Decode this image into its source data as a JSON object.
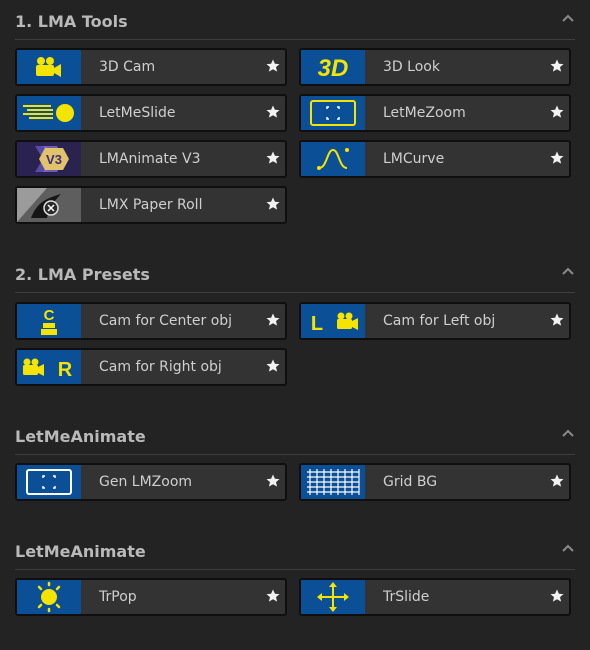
{
  "colors": {
    "background": "#232323",
    "item_bg": "#333333",
    "thumb_blue": "#0b4f96",
    "icon_yellow": "#f5e400",
    "text": "#cfcfcf",
    "header_text": "#b9b9b9"
  },
  "sections": [
    {
      "title": "1. LMA Tools",
      "items": [
        {
          "label": "3D Cam",
          "icon": "camera-icon"
        },
        {
          "label": "3D Look",
          "icon": "3d-text-icon"
        },
        {
          "label": "LetMeSlide",
          "icon": "slide-icon"
        },
        {
          "label": "LetMeZoom",
          "icon": "zoom-frame-icon"
        },
        {
          "label": "LMAnimate V3",
          "icon": "v3-logo-icon"
        },
        {
          "label": "LMCurve",
          "icon": "curve-icon"
        },
        {
          "label": "LMX Paper Roll",
          "icon": "paper-roll-icon"
        }
      ]
    },
    {
      "title": "2. LMA Presets",
      "items": [
        {
          "label": "Cam for Center obj",
          "icon": "center-cam-icon"
        },
        {
          "label": "Cam for Left obj",
          "icon": "left-cam-icon"
        },
        {
          "label": "Cam for Right obj",
          "icon": "right-cam-icon"
        }
      ]
    },
    {
      "title": "LetMeAnimate",
      "items": [
        {
          "label": "Gen LMZoom",
          "icon": "zoom-frame-icon"
        },
        {
          "label": "Grid BG",
          "icon": "grid-icon"
        }
      ]
    },
    {
      "title": "LetMeAnimate",
      "items": [
        {
          "label": "TrPop",
          "icon": "pop-icon"
        },
        {
          "label": "TrSlide",
          "icon": "move-arrows-icon"
        }
      ]
    }
  ]
}
